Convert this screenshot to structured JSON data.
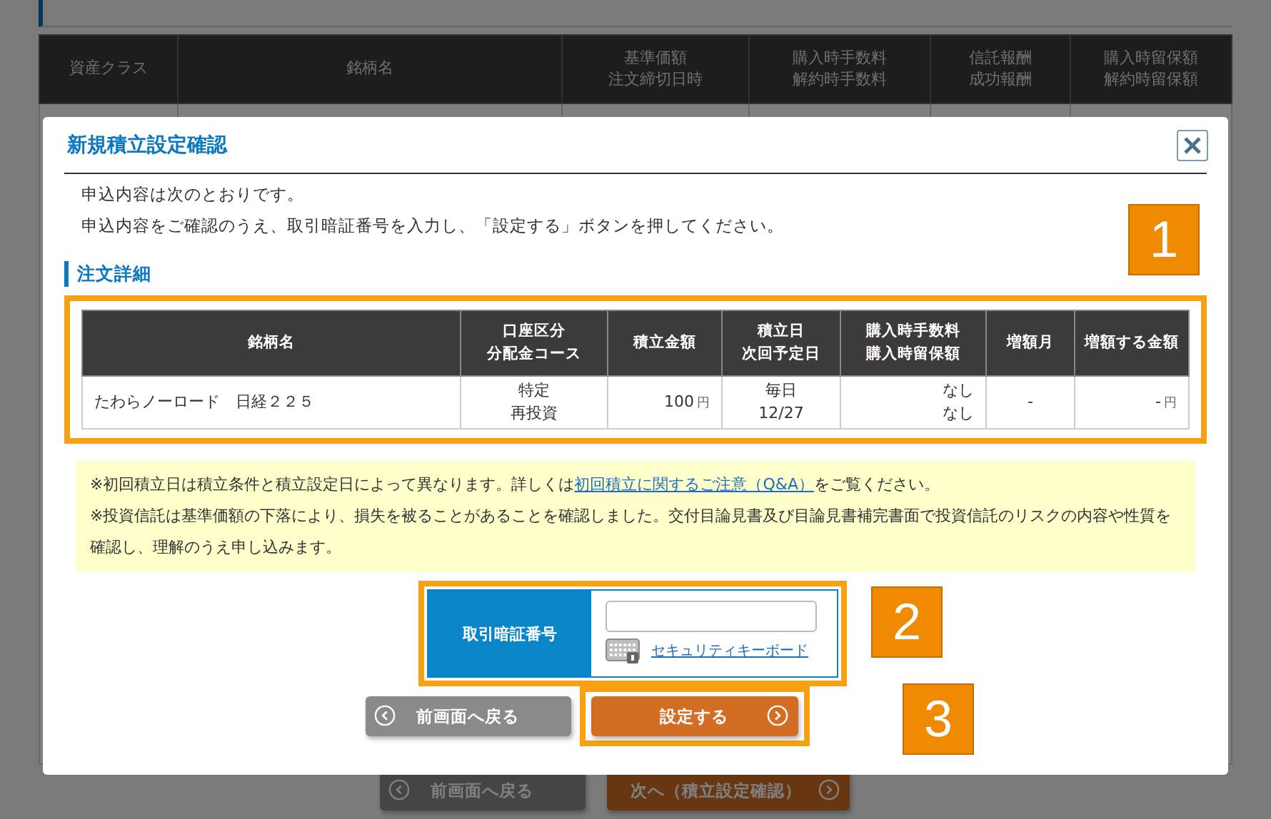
{
  "background": {
    "table": {
      "columns": [
        {
          "lines": [
            "資産クラス"
          ]
        },
        {
          "lines": [
            "銘柄名"
          ]
        },
        {
          "lines": [
            "基準価額",
            "注文締切日時"
          ]
        },
        {
          "lines": [
            "購入時手数料",
            "解約時手数料"
          ]
        },
        {
          "lines": [
            "信託報酬",
            "成功報酬"
          ]
        },
        {
          "lines": [
            "購入時留保額",
            "解約時留保額"
          ]
        }
      ]
    },
    "buttons": [
      {
        "label": "前画面へ戻る",
        "kind": "back"
      },
      {
        "label": "次へ（積立設定確認）",
        "kind": "next"
      }
    ]
  },
  "modal": {
    "title": "新規積立設定確認",
    "intro": [
      "申込内容は次のとおりです。",
      "申込内容をご確認のうえ、取引暗証番号を入力し、「設定する」ボタンを押してください。"
    ],
    "section_title": "注文詳細",
    "table": {
      "columns": [
        {
          "lines": [
            "銘柄名"
          ]
        },
        {
          "lines": [
            "口座区分",
            "分配金コース"
          ]
        },
        {
          "lines": [
            "積立金額"
          ]
        },
        {
          "lines": [
            "積立日",
            "次回予定日"
          ]
        },
        {
          "lines": [
            "購入時手数料",
            "購入時留保額"
          ]
        },
        {
          "lines": [
            "増額月"
          ]
        },
        {
          "lines": [
            "増額する金額"
          ]
        }
      ],
      "rows": [
        [
          {
            "lines": [
              "たわらノーロード　日経２２５"
            ]
          },
          {
            "lines": [
              "特定",
              "再投資"
            ]
          },
          {
            "lines": [
              "100"
            ],
            "unit": "円"
          },
          {
            "lines": [
              "毎日",
              "12/27"
            ]
          },
          {
            "lines": [
              "なし",
              "なし"
            ]
          },
          {
            "lines": [
              "-"
            ]
          },
          {
            "lines": [
              "-"
            ],
            "unit": "円"
          }
        ]
      ]
    },
    "notes": [
      {
        "before": "※初回積立日は積立条件と積立設定日によって異なります。詳しくは",
        "link": "初回積立に関するご注意（Q&A）",
        "after": "をご覧ください。"
      },
      {
        "before": "※投資信託は基準価額の下落により、損失を被ることがあることを確認しました。交付目論見書及び目論見書補完書面で投資信託のリスクの内容や性質を確認し、理解のうえ申し込みます。"
      }
    ],
    "auth": {
      "label": "取引暗証番号",
      "keyboard_link": "セキュリティキーボード"
    },
    "buttons": [
      {
        "label": "前画面へ戻る",
        "kind": "back"
      },
      {
        "label": "設定する",
        "kind": "submit"
      }
    ],
    "annotations": [
      "1",
      "2",
      "3"
    ]
  }
}
